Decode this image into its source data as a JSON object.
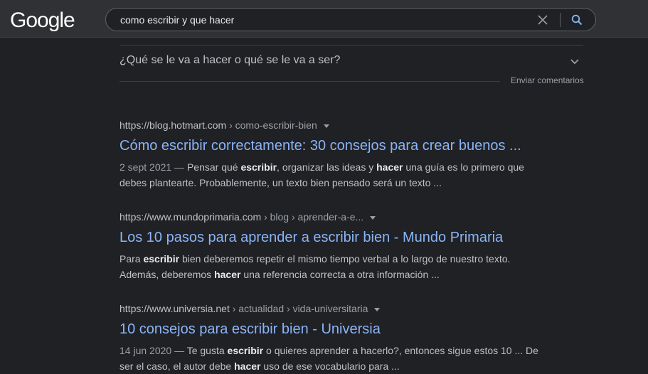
{
  "header": {
    "logo": "Google",
    "search_query": "como escribir y que hacer"
  },
  "faq": {
    "question": "¿Qué se le va a hacer o qué se le va a ser?",
    "feedback": "Enviar comentarios"
  },
  "results": [
    {
      "url_domain": "https://blog.hotmart.com",
      "url_path": " › como-escribir-bien",
      "title": "Cómo escribir correctamente: 30 consejos para crear buenos ...",
      "snippet": [
        {
          "t": "2 sept 2021 — ",
          "k": "date"
        },
        {
          "t": "Pensar qué ",
          "k": "text"
        },
        {
          "t": "escribir",
          "k": "bold"
        },
        {
          "t": ", organizar las ideas y ",
          "k": "text"
        },
        {
          "t": "hacer",
          "k": "bold"
        },
        {
          "t": " una guía es lo primero que debes plantearte. Probablemente, un texto bien pensado será un texto ...",
          "k": "text"
        }
      ]
    },
    {
      "url_domain": "https://www.mundoprimaria.com",
      "url_path": " › blog › aprender-a-e...",
      "title": "Los 10 pasos para aprender a escribir bien - Mundo Primaria",
      "snippet": [
        {
          "t": "Para ",
          "k": "text"
        },
        {
          "t": "escribir",
          "k": "bold"
        },
        {
          "t": " bien deberemos repetir el mismo tiempo verbal a lo largo de nuestro texto. Además, deberemos ",
          "k": "text"
        },
        {
          "t": "hacer",
          "k": "bold"
        },
        {
          "t": " una referencia correcta a otra información ...",
          "k": "text"
        }
      ]
    },
    {
      "url_domain": "https://www.universia.net",
      "url_path": " › actualidad › vida-universitaria",
      "title": "10 consejos para escribir bien - Universia",
      "snippet": [
        {
          "t": "14 jun 2020 — ",
          "k": "date"
        },
        {
          "t": "Te gusta ",
          "k": "text"
        },
        {
          "t": "escribir",
          "k": "bold"
        },
        {
          "t": " o quieres aprender a hacerlo?, entonces sigue estos 10 ... De ser el caso, el autor debe ",
          "k": "text"
        },
        {
          "t": "hacer",
          "k": "bold"
        },
        {
          "t": " uso de ese vocabulario para ...",
          "k": "text"
        }
      ]
    }
  ],
  "icons": {
    "clear": "close-icon",
    "search": "search-icon",
    "expand": "chevron-down-icon",
    "url_menu": "caret-down-icon"
  },
  "colors": {
    "background": "#202124",
    "header": "#303134",
    "link": "#8ab4f8",
    "text": "#bdc1c6",
    "search_icon": "#8ab4f8"
  }
}
